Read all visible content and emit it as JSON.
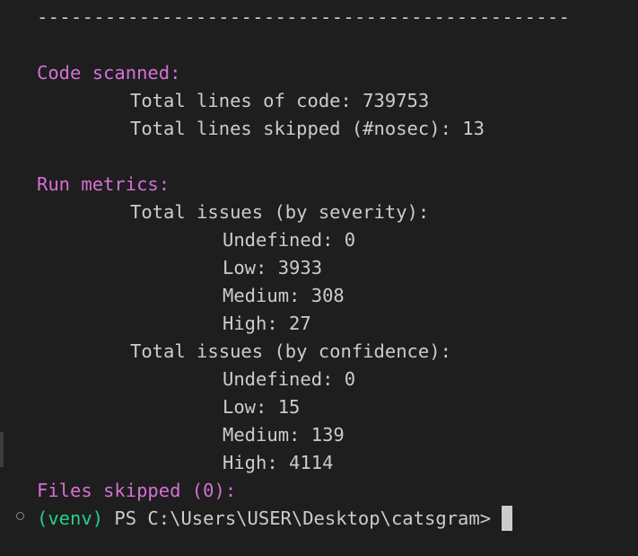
{
  "separator": "-----------------------------------------------",
  "code_scanned": {
    "heading": "Code scanned:",
    "total_lines": "Total lines of code: 739753",
    "lines_skipped": "Total lines skipped (#nosec): 13"
  },
  "run_metrics": {
    "heading": "Run metrics:",
    "severity_heading": "Total issues (by severity):",
    "severity": [
      "Undefined: 0",
      "Low: 3933",
      "Medium: 308",
      "High: 27"
    ],
    "confidence_heading": "Total issues (by confidence):",
    "confidence": [
      "Undefined: 0",
      "Low: 15",
      "Medium: 139",
      "High: 4114"
    ]
  },
  "files_skipped": "Files skipped (0):",
  "prompt": {
    "venv": "(venv)",
    "path": " PS C:\\Users\\USER\\Desktop\\catsgram>"
  },
  "colors": {
    "background": "#1e1e1e",
    "text": "#cccccc",
    "heading": "#d670d6",
    "venv": "#23d18b"
  },
  "icons": {
    "prompt_marker": "circle-outline-icon",
    "cursor": "block-cursor"
  }
}
